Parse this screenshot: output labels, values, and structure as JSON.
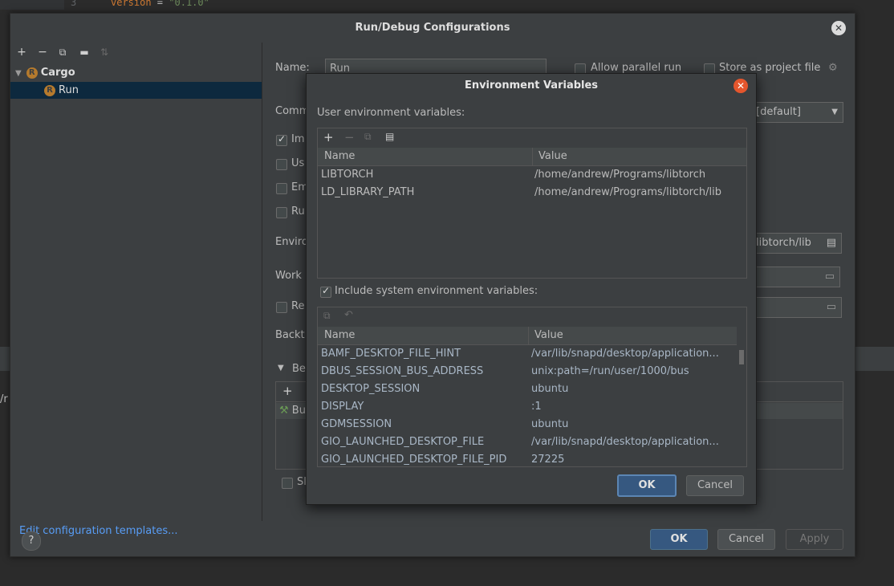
{
  "editor": {
    "line_number": "3",
    "code_key": "version",
    "code_eq": " = ",
    "code_val": "\"0.1.0\"",
    "bg_text": "/r"
  },
  "main_dialog": {
    "title": "Run/Debug Configurations",
    "tree": {
      "group": "Cargo",
      "item": "Run"
    },
    "edit_templates": "Edit configuration templates...",
    "form": {
      "name_label": "Name:",
      "name_value": "Run",
      "allow_parallel": "Allow parallel run",
      "store_project": "Store as project file",
      "command_label": "Comm",
      "channel_value": "[default]",
      "cb1": "Im",
      "cb2": "Us",
      "cb3": "Em",
      "cb4": "Ru",
      "env_label": "Enviro",
      "env_value": "libtorch/lib",
      "workdir_label": "Work",
      "redirect_label": "Re",
      "backtrace_label": "Backt",
      "before_label": "Be",
      "before_item": "Bu",
      "show_label": "Sl"
    },
    "buttons": {
      "help": "?",
      "ok": "OK",
      "cancel": "Cancel",
      "apply": "Apply"
    }
  },
  "env_dialog": {
    "title": "Environment Variables",
    "user_label": "User environment variables:",
    "columns": {
      "name": "Name",
      "value": "Value"
    },
    "user_vars": [
      {
        "name": "LIBTORCH",
        "value": "/home/andrew/Programs/libtorch"
      },
      {
        "name": "LD_LIBRARY_PATH",
        "value": "/home/andrew/Programs/libtorch/lib"
      }
    ],
    "include_system": "Include system environment variables:",
    "system_vars": [
      {
        "name": "BAMF_DESKTOP_FILE_HINT",
        "value": "/var/lib/snapd/desktop/application..."
      },
      {
        "name": "DBUS_SESSION_BUS_ADDRESS",
        "value": "unix:path=/run/user/1000/bus"
      },
      {
        "name": "DESKTOP_SESSION",
        "value": "ubuntu"
      },
      {
        "name": "DISPLAY",
        "value": ":1"
      },
      {
        "name": "GDMSESSION",
        "value": "ubuntu"
      },
      {
        "name": "GIO_LAUNCHED_DESKTOP_FILE",
        "value": "/var/lib/snapd/desktop/application..."
      },
      {
        "name": "GIO_LAUNCHED_DESKTOP_FILE_PID",
        "value": "27225"
      }
    ],
    "buttons": {
      "ok": "OK",
      "cancel": "Cancel"
    }
  }
}
